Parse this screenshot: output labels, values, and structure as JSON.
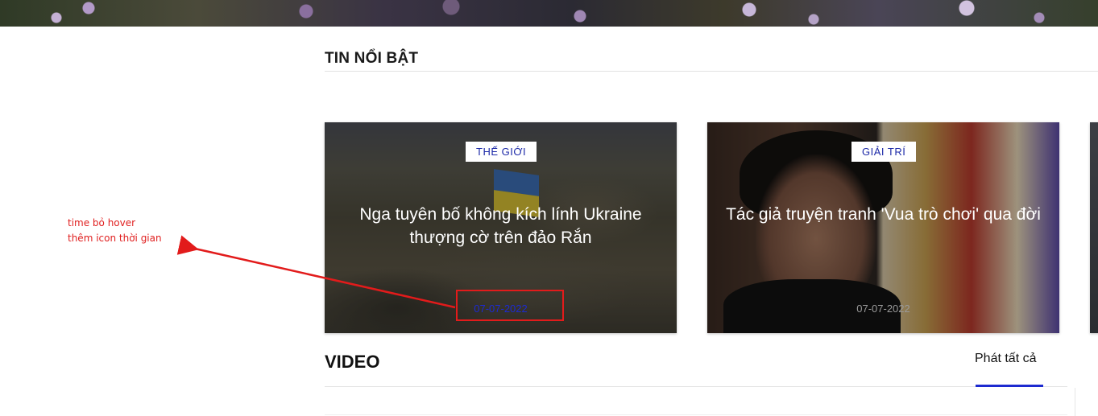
{
  "featured": {
    "title": "TIN NỔI BẬT",
    "cards": [
      {
        "category": "THẾ GIỚI",
        "title": "Nga tuyên bố không kích lính Ukraine thượng cờ trên đảo Rắn",
        "date": "07-07-2022"
      },
      {
        "category": "GIẢI TRÍ",
        "title": "Tác giả truyện tranh 'Vua trò chơi' qua đời",
        "date": "07-07-2022"
      }
    ]
  },
  "annotation": {
    "line1": "time bỏ hover",
    "line2": "thêm icon thời gian",
    "color": "#e02020"
  },
  "video": {
    "title": "VIDEO",
    "play_all": "Phát tất cả"
  },
  "colors": {
    "accent": "#1d2ad0",
    "category_text": "#1d2aa8"
  }
}
